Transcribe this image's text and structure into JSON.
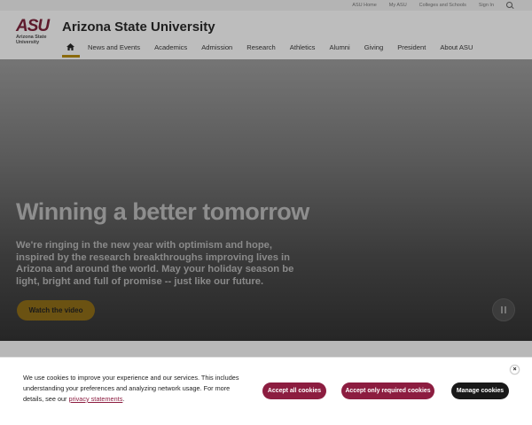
{
  "utility": {
    "links": [
      "ASU Home",
      "My ASU",
      "Colleges and Schools",
      "Sign In"
    ],
    "search_icon": "search-icon"
  },
  "header": {
    "logo_mark": "ASU",
    "logo_sub_1": "Arizona State",
    "logo_sub_2": "University",
    "site_title": "Arizona State University",
    "home_icon": "home-icon",
    "nav": [
      "News and Events",
      "Academics",
      "Admission",
      "Research",
      "Athletics",
      "Alumni",
      "Giving",
      "President",
      "About ASU"
    ]
  },
  "hero": {
    "title": "Winning a better tomorrow",
    "body": "We're ringing in the new year with optimism and hope, inspired by the research breakthroughs improving lives in Arizona and around the world. May your holiday season be light, bright and full of promise -- just like our future.",
    "cta_label": "Watch the video",
    "pause_icon": "pause-icon"
  },
  "cookie": {
    "text_main": "We use cookies to improve your experience and our services. This includes understanding your preferences and analyzing network usage. For more details, see our ",
    "link_text": "privacy statements",
    "text_end": ".",
    "accept_all": "Accept all cookies",
    "accept_required": "Accept only required cookies",
    "manage": "Manage cookies",
    "close_symbol": "×"
  },
  "colors": {
    "maroon": "#8c1d40",
    "gold": "#ffc627",
    "dark": "#191919"
  }
}
